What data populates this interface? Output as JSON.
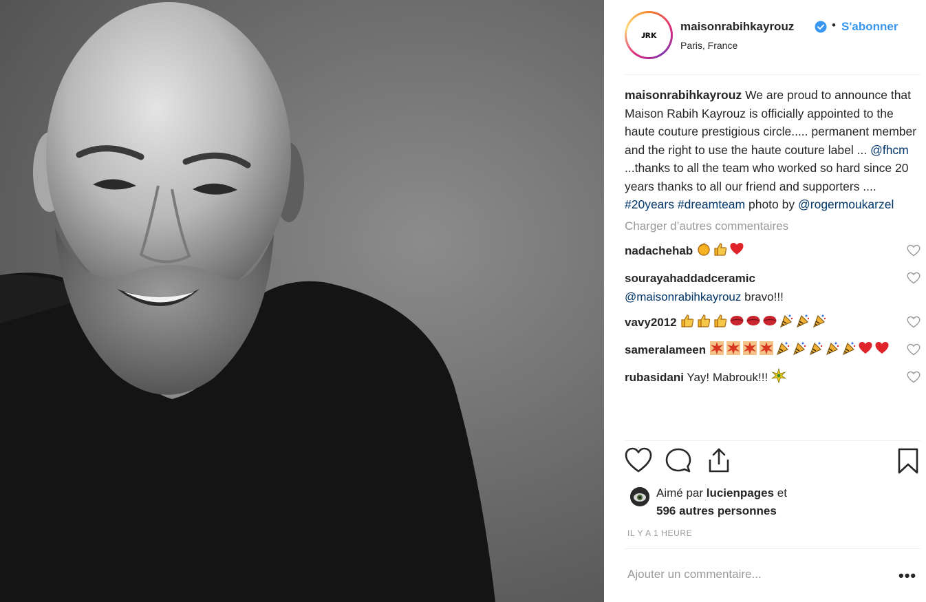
{
  "post": {
    "username": "maisonrabihkayrouz",
    "follow_label": "S'abonner",
    "separator": "•",
    "location": "Paris, France",
    "avatar_logo": "ᴊʀᴋ",
    "caption_username": "maisonrabihkayrouz",
    "caption_part1": " We are proud to announce that Maison Rabih Kayrouz is officially appointed to the haute couture prestigious circle..... permanent member and the right to use the haute couture label ... ",
    "caption_mention1": "@fhcm",
    "caption_part2": " ...thanks to all the team who worked so hard since 20 years thanks to all our friend and supporters .... ",
    "caption_hashtag1": "#20years",
    "caption_hashtag2": "#dreamteam",
    "caption_part3": " photo by ",
    "caption_mention2": "@rogermoukarzel",
    "load_more_label": "Charger d’autres commentaires"
  },
  "comments": [
    {
      "user": "nadachehab",
      "text": "",
      "emojis": [
        "clap",
        "thumbs",
        "heart"
      ]
    },
    {
      "user": "sourayahaddadceramic",
      "mention": "@maisonrabihkayrouz",
      "text": " bravo!!!"
    },
    {
      "user": "vavy2012",
      "text": "",
      "emojis": [
        "thumbs",
        "thumbs",
        "thumbs",
        "kiss",
        "kiss",
        "kiss",
        "party",
        "party",
        "party"
      ]
    },
    {
      "user": "sameralameen",
      "text": "",
      "emojis": [
        "anger",
        "anger",
        "anger",
        "anger",
        "party",
        "party",
        "party",
        "party",
        "party",
        "heart",
        "heart"
      ]
    },
    {
      "user": "rubasidani",
      "text": " Yay! Mabrouk!!! ",
      "emojis": [
        "sparkle"
      ]
    }
  ],
  "likes": {
    "prefix": "Aimé par ",
    "user": "lucienpages",
    "suffix": " et",
    "count_text": "596 autres personnes"
  },
  "timestamp": "IL Y A 1 HEURE",
  "add_comment_placeholder": "Ajouter un commentaire...",
  "more_label": "•••",
  "colors": {
    "link": "#003569",
    "follow": "#3897f0",
    "muted": "#999999",
    "heart_red": "#ed4956"
  }
}
